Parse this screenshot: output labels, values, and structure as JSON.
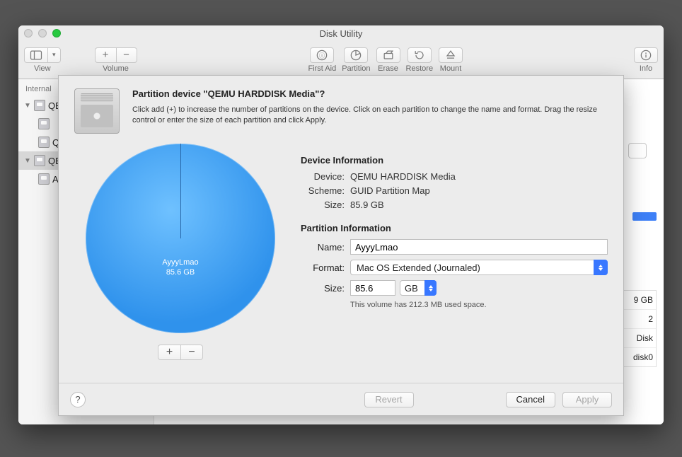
{
  "window": {
    "title": "Disk Utility"
  },
  "toolbar": {
    "view": "View",
    "volume": "Volume",
    "first_aid": "First Aid",
    "partition": "Partition",
    "erase": "Erase",
    "restore": "Restore",
    "mount": "Mount",
    "info": "Info"
  },
  "sidebar": {
    "section0": "Internal",
    "items": [
      {
        "label": "QE"
      },
      {
        "label": ""
      },
      {
        "label": "QE"
      },
      {
        "label": "QE"
      },
      {
        "label": "A"
      }
    ]
  },
  "sheet": {
    "heading": "Partition device \"QEMU HARDDISK Media\"?",
    "desc": "Click add (+) to increase the number of partitions on the device. Click on each partition to change the name and format. Drag the resize control or enter the size of each partition and click Apply.",
    "pie": {
      "name": "AyyyLmao",
      "size": "85.6 GB"
    },
    "device_info_h": "Device Information",
    "device": {
      "k": "Device:",
      "v": "QEMU HARDDISK Media"
    },
    "scheme": {
      "k": "Scheme:",
      "v": "GUID Partition Map"
    },
    "dsize": {
      "k": "Size:",
      "v": "85.9 GB"
    },
    "part_info_h": "Partition Information",
    "name": {
      "k": "Name:",
      "v": "AyyyLmao"
    },
    "format": {
      "k": "Format:",
      "v": "Mac OS Extended (Journaled)"
    },
    "psize": {
      "k": "Size:",
      "v": "85.6",
      "unit": "GB"
    },
    "used": "This volume has 212.3 MB used space.",
    "help": "?",
    "revert": "Revert",
    "cancel": "Cancel",
    "apply": "Apply"
  },
  "bg": {
    "cap": "9 GB",
    "cnt": "2",
    "type": "Disk",
    "dev": "disk0"
  },
  "chart_data": {
    "type": "pie",
    "title": "",
    "categories": [
      "AyyyLmao"
    ],
    "values": [
      85.6
    ],
    "unit": "GB",
    "series": [
      {
        "name": "AyyyLmao",
        "values": [
          85.6
        ]
      }
    ]
  }
}
